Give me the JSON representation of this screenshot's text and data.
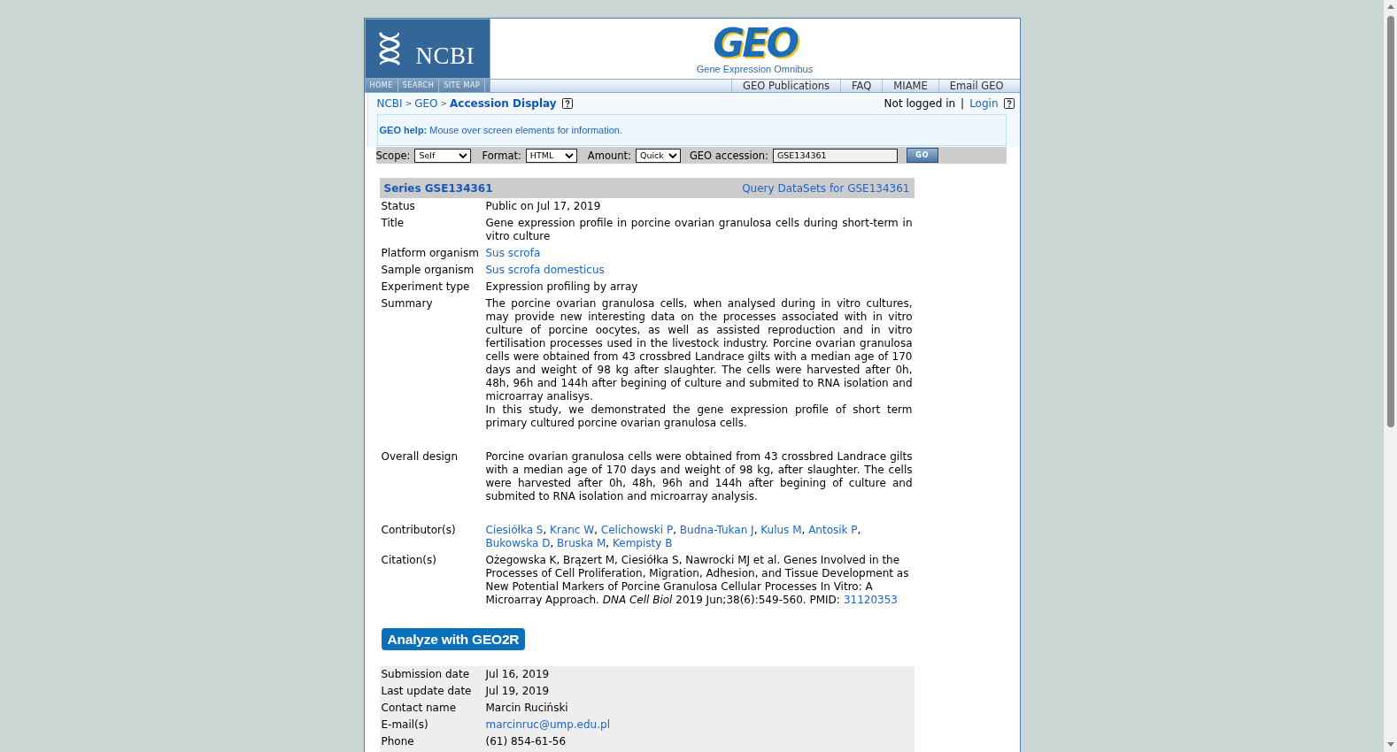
{
  "header": {
    "ncbi_logo": "NCBI",
    "geo_logo": {
      "title": "GEO",
      "subtitle": "Gene Expression Omnibus"
    }
  },
  "nav": {
    "site_links": [
      "HOME",
      "SEARCH",
      "SITE MAP"
    ],
    "geo_links": [
      "GEO Publications",
      "FAQ",
      "MIAME",
      "Email GEO"
    ]
  },
  "breadcrumb": [
    {
      "kind": "link",
      "text": "NCBI"
    },
    {
      "kind": "separator",
      "text": ">"
    },
    {
      "kind": "link",
      "text": "GEO"
    },
    {
      "kind": "separator",
      "text": ">"
    },
    {
      "kind": "current",
      "text": "Accession Display"
    }
  ],
  "account": [
    {
      "kind": "status",
      "text": "Not logged in"
    },
    {
      "kind": "separator",
      "text": "|"
    },
    {
      "kind": "link",
      "text": "Login"
    }
  ],
  "help_box": "**GEO help:** Mouse over screen elements for information.",
  "query_bar": {
    "fields": [
      {
        "kind": "select",
        "label": "Scope:",
        "value": "Self"
      },
      {
        "kind": "select",
        "label": "Format:",
        "value": "HTML"
      },
      {
        "kind": "select",
        "label": "Amount:",
        "value": "Quick"
      },
      {
        "kind": "input",
        "label": "GEO accession:",
        "value": "GSE134361"
      }
    ],
    "button": "GO"
  },
  "series": {
    "title": "Series GSE134361",
    "query_link": "Query DataSets for GSE134361",
    "rows": [
      {
        "label": "Status",
        "kind": "text",
        "value": "Public on Jul 17, 2019"
      },
      {
        "label": "Title",
        "kind": "text",
        "value": "Gene expression profile in porcine ovarian granulosa cells during short-term in vitro culture"
      },
      {
        "label": "Platform organism",
        "kind": "link",
        "value": "Sus scrofa"
      },
      {
        "label": "Sample organism",
        "kind": "link",
        "value": "Sus scrofa domesticus"
      },
      {
        "label": "Experiment type",
        "kind": "text",
        "value": "Expression profiling by array"
      },
      {
        "label": "Summary",
        "kind": "paragraphs",
        "paragraphs": [
          "The porcine ovarian granulosa cells, when analysed during in vitro cultures, may provide new interesting data on the processes associated with in vitro culture of porcine oocytes, as well as assisted reproduction and in vitro fertilisation processes used in the livestock industry. Porcine ovarian granulosa cells were obtained from 43 crossbred Landrace gilts with a median age of 170 days and weight of 98 kg after slaughter. The cells were harvested after 0h, 48h, 96h and 144h after begining of culture and submited to RNA isolation and microarray analisys.",
          "In this study, we demonstrated the gene expression profile of short term primary cultured porcine ovarian granulosa cells."
        ]
      },
      {
        "label": "Overall design",
        "kind": "paragraphs",
        "paragraphs": [
          "Porcine ovarian granulosa cells were obtained from 43 crossbred Landrace gilts with a median age of 170 days and weight of 98 kg, after slaughter. The cells were harvested after 0h, 48h, 96h and 144h after begining of culture and submited to RNA isolation and microarray analysis."
        ]
      },
      {
        "label": "Contributor(s)",
        "kind": "links",
        "separator": ", ",
        "links": [
          "Ciesiółka S",
          "Kranc W",
          "Celichowski P",
          "Budna-Tukan J",
          "Kulus M",
          "Antosik P",
          "Bukowska D",
          "Bruska M",
          "Kempisty B"
        ]
      },
      {
        "label": "Citation(s)",
        "kind": "citation",
        "text": "Ożegowska K, Brązert M, Ciesiółka S, Nawrocki MJ et al. Genes Involved in the Processes of Cell Proliferation, Migration, Adhesion, and Tissue Development as New Potential Markers of Porcine Granulosa Cellular Processes In Vitro: A Microarray Approach. *DNA Cell Biol* 2019 Jun;38(6):549-560. PMID:",
        "link": "31120353"
      }
    ]
  },
  "analyze_button": "Analyze with GEO2R",
  "details": {
    "rows": [
      {
        "label": "Submission date",
        "kind": "text",
        "value": "Jul 16, 2019"
      },
      {
        "label": "Last update date",
        "kind": "text",
        "value": "Jul 19, 2019"
      },
      {
        "label": "Contact name",
        "kind": "text",
        "value": "Marcin Ruciński"
      },
      {
        "label": "E-mail(s)",
        "kind": "link",
        "value": "marcinruc@ump.edu.pl"
      },
      {
        "label": "Phone",
        "kind": "text",
        "value": "(61) 854-61-56"
      }
    ]
  }
}
